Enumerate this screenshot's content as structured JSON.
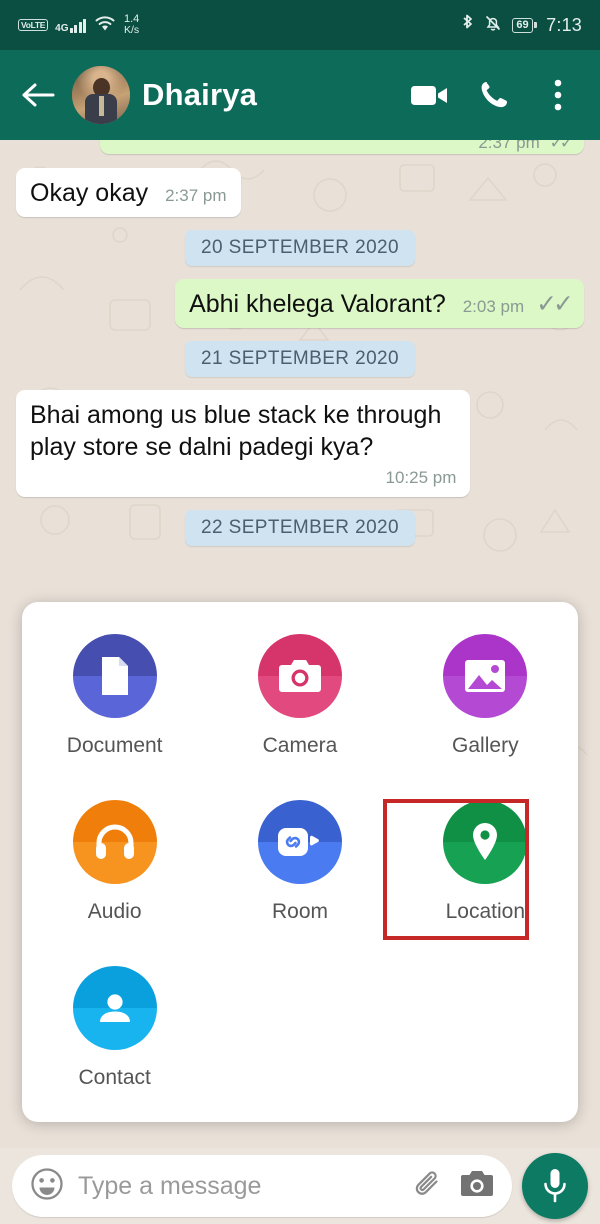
{
  "status_bar": {
    "volte": "VoLTE",
    "network": "4G",
    "data_rate_value": "1.4",
    "data_rate_unit": "K/s",
    "battery": "69",
    "time": "7:13",
    "icons": [
      "volte-icon",
      "signal-bars-icon",
      "wifi-icon",
      "bluetooth-icon",
      "mute-icon",
      "battery-icon"
    ]
  },
  "header": {
    "title": "Dhairya",
    "back_icon": "back-arrow-icon",
    "avatar_icon": "contact-avatar",
    "video_call_icon": "video-call-icon",
    "voice_call_icon": "phone-call-icon",
    "overflow_icon": "more-options-icon"
  },
  "chat": {
    "clipped_message": {
      "time": "2:37 pm",
      "ticks": "✓✓"
    },
    "items": [
      {
        "kind": "message",
        "direction": "incoming",
        "text": "Okay okay",
        "time": "2:37 pm",
        "meta_layout": "inline"
      },
      {
        "kind": "date",
        "text": "20 SEPTEMBER 2020"
      },
      {
        "kind": "message",
        "direction": "outgoing",
        "text": "Abhi khelega Valorant?",
        "time": "2:03 pm",
        "ticks": "✓✓",
        "meta_layout": "inline"
      },
      {
        "kind": "date",
        "text": "21 SEPTEMBER 2020"
      },
      {
        "kind": "message",
        "direction": "incoming",
        "text": "Bhai among us blue stack ke through play store se dalni padegi kya?",
        "time": "10:25 pm",
        "meta_layout": "block"
      },
      {
        "kind": "date",
        "text": "22 SEPTEMBER 2020"
      }
    ]
  },
  "attachment_panel": {
    "items": [
      {
        "label": "Document",
        "icon": "document-icon",
        "color_top": "#464fb0",
        "color_bottom": "#5a66d8",
        "highlighted": false
      },
      {
        "label": "Camera",
        "icon": "camera-icon",
        "color_top": "#d6356b",
        "color_bottom": "#e24a7f",
        "highlighted": false
      },
      {
        "label": "Gallery",
        "icon": "gallery-icon",
        "color_top": "#ab34c9",
        "color_bottom": "#b44ad4",
        "highlighted": false
      },
      {
        "label": "Audio",
        "icon": "headphones-icon",
        "color_top": "#f07e0a",
        "color_bottom": "#f79420",
        "highlighted": false
      },
      {
        "label": "Room",
        "icon": "messenger-room-icon",
        "color_top": "#3a61d0",
        "color_bottom": "#4a7bf0",
        "highlighted": false
      },
      {
        "label": "Location",
        "icon": "location-pin-icon",
        "color_top": "#0f9045",
        "color_bottom": "#17a152",
        "highlighted": true
      },
      {
        "label": "Contact",
        "icon": "person-icon",
        "color_top": "#0aa0de",
        "color_bottom": "#17b4ef",
        "highlighted": false
      }
    ],
    "highlight_color": "#c62828"
  },
  "input_bar": {
    "placeholder": "Type a message",
    "emoji_icon": "emoji-smiley-icon",
    "attach_icon": "paperclip-icon",
    "camera_icon": "camera-icon",
    "mic_icon": "microphone-icon"
  },
  "colors": {
    "status_bar": "#0b4f42",
    "header": "#0d6b5a",
    "chat_background": "#e9e1d8",
    "outgoing_bubble": "#dcf8c6",
    "incoming_bubble": "#ffffff",
    "date_chip": "#cfe3f0",
    "mic_button": "#0d7a63"
  }
}
